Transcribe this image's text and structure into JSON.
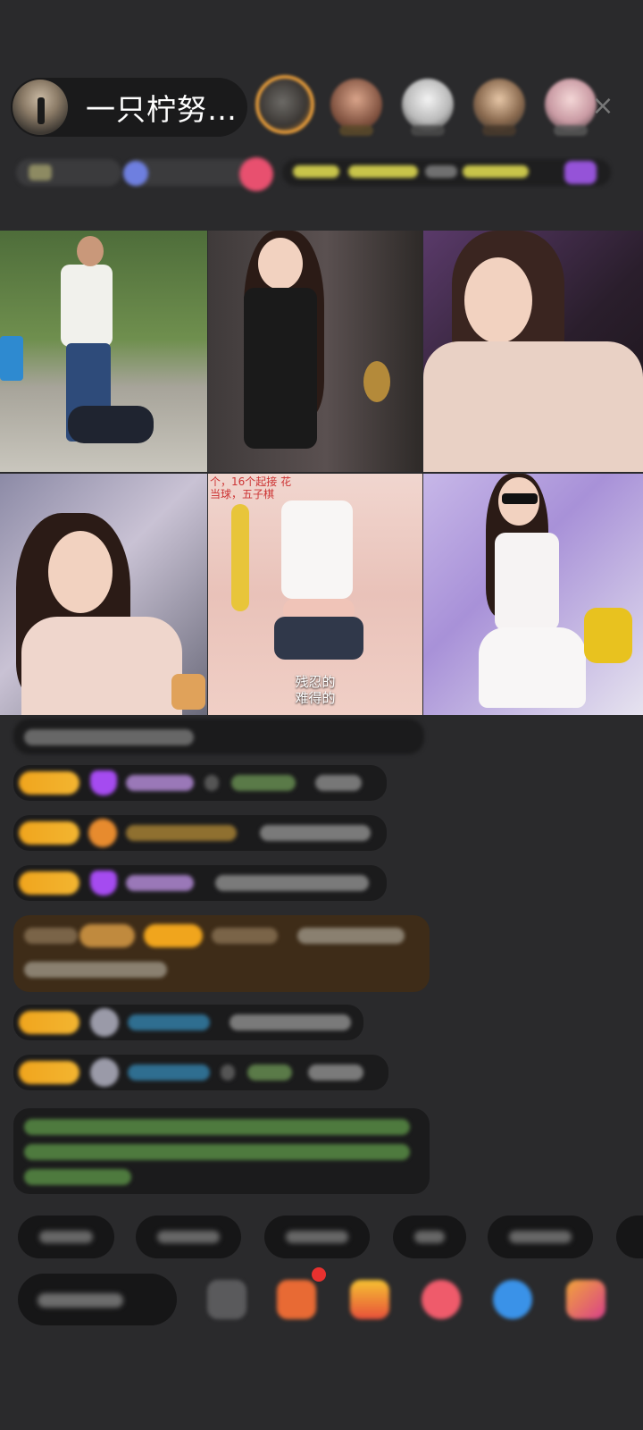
{
  "host": {
    "name": "一只柠努…",
    "avatar": "host-avatar"
  },
  "viewers": [
    "viewer-avatar",
    "viewer-avatar",
    "viewer-avatar",
    "viewer-avatar",
    "viewer-avatar"
  ],
  "close_icon": "×",
  "grid": {
    "tiles": [
      {
        "caption": ""
      },
      {
        "caption": ""
      },
      {
        "caption": ""
      },
      {
        "caption": ""
      },
      {
        "caption_top_line1": "个，16个起接   花",
        "caption_top_line2": "当球，五子棋",
        "caption_line1": "残忍的",
        "caption_line2": "难得的"
      },
      {
        "caption": ""
      }
    ]
  },
  "colors": {
    "background": "#2a2a2c",
    "badge": "#f0a51d",
    "gem": "#a54bf0",
    "greenText": "#5fb34a",
    "blueName": "#4a8fc0"
  }
}
